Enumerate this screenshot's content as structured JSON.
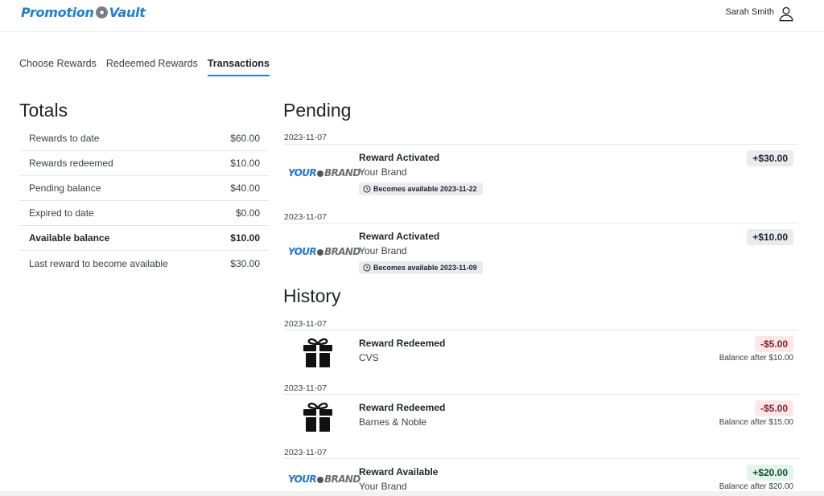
{
  "header": {
    "logo_left": "Promotion",
    "logo_right": "Vault",
    "user_name": "Sarah Smith"
  },
  "tabs": [
    "Choose Rewards",
    "Redeemed Rewards",
    "Transactions"
  ],
  "totals": {
    "title": "Totals",
    "rows": [
      {
        "label": "Rewards to date",
        "value": "$60.00"
      },
      {
        "label": "Rewards redeemed",
        "value": "$10.00"
      },
      {
        "label": "Pending balance",
        "value": "$40.00"
      },
      {
        "label": "Expired to date",
        "value": "$0.00"
      },
      {
        "label": "Available balance",
        "value": "$10.00"
      },
      {
        "label": "Last reward to become available",
        "value": "$30.00"
      }
    ]
  },
  "pending": {
    "title": "Pending",
    "items": [
      {
        "date": "2023-11-07",
        "title": "Reward Activated",
        "brand": "Your Brand",
        "chip": "Becomes available 2023-11-22",
        "amount": "+$30.00"
      },
      {
        "date": "2023-11-07",
        "title": "Reward Activated",
        "brand": "Your Brand",
        "chip": "Becomes available 2023-11-09",
        "amount": "+$10.00"
      }
    ]
  },
  "history": {
    "title": "History",
    "items": [
      {
        "date": "2023-11-07",
        "title": "Reward Redeemed",
        "brand": "CVS",
        "amount": "-$5.00",
        "balance": "Balance after $10.00"
      },
      {
        "date": "2023-11-07",
        "title": "Reward Redeemed",
        "brand": "Barnes & Noble",
        "amount": "-$5.00",
        "balance": "Balance after $15.00"
      },
      {
        "date": "2023-11-07",
        "title": "Reward Available",
        "brand": "Your Brand",
        "amount": "+$20.00",
        "balance": "Balance after $20.00"
      }
    ]
  },
  "brand_logo": {
    "left": "YOUR",
    "right": "BRAND"
  },
  "colors": {
    "accent": "#2c7be5",
    "logo_blue": "#1f7fd6",
    "negative_bg": "#fbe7e9",
    "positive_bg": "#e4f4ea"
  }
}
